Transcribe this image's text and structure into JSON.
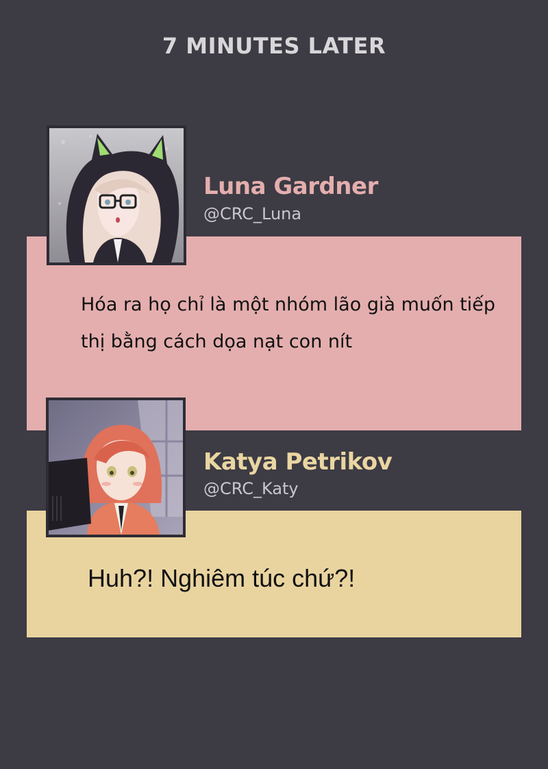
{
  "header": {
    "caption": "7 MINUTES LATER"
  },
  "posts": [
    {
      "name": "Luna Gardner",
      "handle": "@CRC_Luna",
      "message": "Hóa ra họ chỉ là một nhóm lão già muốn tiếp thị bằng cách dọa nạt con nít",
      "accent_color": "#e4aeae"
    },
    {
      "name": "Katya Petrikov",
      "handle": "@CRC_Katy",
      "message": "Huh?! Nghiêm túc chứ?!",
      "accent_color": "#e9d4a0"
    }
  ],
  "colors": {
    "background": "#3d3b44",
    "header_text": "#d8d6d8",
    "handle_text": "#c9c7ca"
  }
}
